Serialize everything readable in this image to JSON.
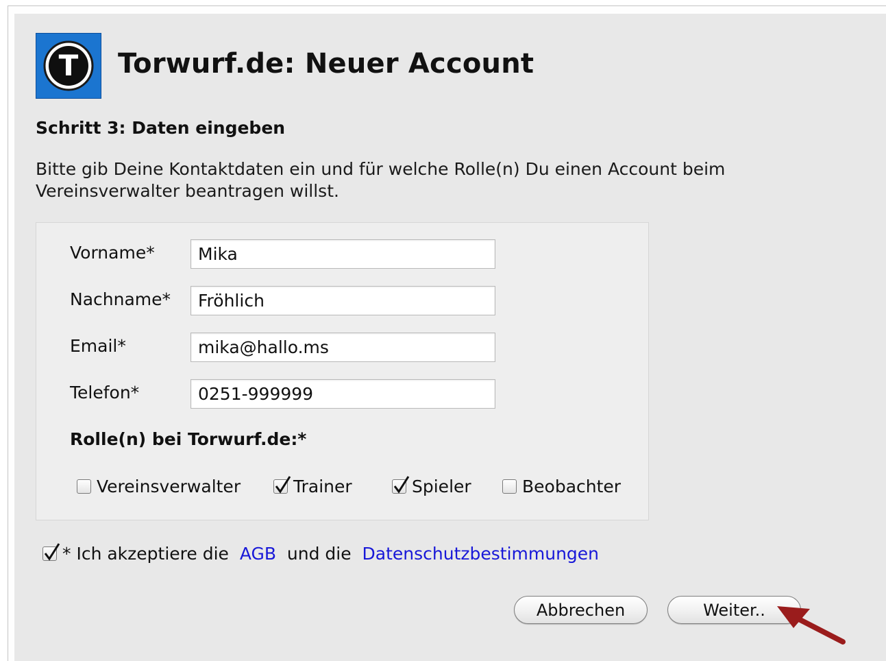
{
  "header": {
    "title": "Torwurf.de: Neuer Account",
    "logo_letter": "T"
  },
  "step_title": "Schritt 3: Daten eingeben",
  "intro_text": "Bitte gib Deine Kontaktdaten ein und für welche Rolle(n) Du einen Account beim Vereinsverwalter beantragen willst.",
  "form": {
    "fields": [
      {
        "label": "Vorname*",
        "value": "Mika"
      },
      {
        "label": "Nachname*",
        "value": "Fröhlich"
      },
      {
        "label": "Email*",
        "value": "mika@hallo.ms"
      },
      {
        "label": "Telefon*",
        "value": "0251-999999"
      }
    ],
    "roles_heading": "Rolle(n) bei Torwurf.de:*",
    "roles": [
      {
        "label": "Vereinsverwalter",
        "checked": false
      },
      {
        "label": "Trainer",
        "checked": true
      },
      {
        "label": "Spieler",
        "checked": true
      },
      {
        "label": "Beobachter",
        "checked": false
      }
    ]
  },
  "terms": {
    "checked": true,
    "prefix": "* Ich akzeptiere die",
    "agb_link": "AGB",
    "middle": "und die",
    "privacy_link": "Datenschutzbestimmungen"
  },
  "buttons": {
    "cancel_label": "Abbrechen",
    "next_label": "Weiter.."
  },
  "colors": {
    "logo_background": "#1b75d0",
    "link": "#1818d8",
    "panel_background": "#e8e8e8",
    "annotation_arrow": "#9a1c1c"
  },
  "icons": {
    "logo": "torwurf-t-logo",
    "checkbox_mark": "checkmark-icon",
    "annotation": "pointer-arrow-icon"
  }
}
